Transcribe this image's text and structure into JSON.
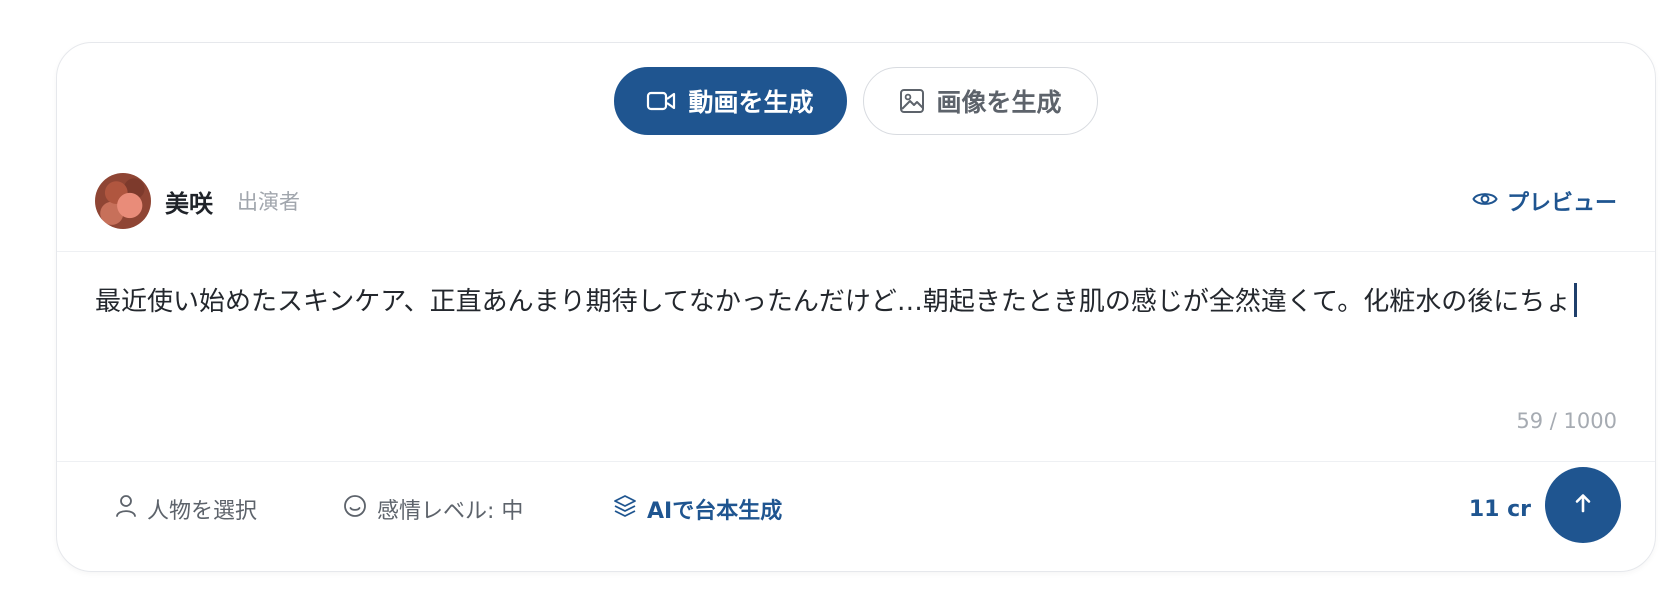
{
  "mode_tabs": {
    "video_label": "動画を生成",
    "image_label": "画像を生成",
    "video_icon": "video-camera-icon",
    "image_icon": "image-icon"
  },
  "performer": {
    "name": "美咲",
    "role": "出演者",
    "preview_label": "プレビュー",
    "preview_icon": "eye-icon"
  },
  "script": {
    "text": "最近使い始めたスキンケア、正直あんまり期待してなかったんだけど…朝起きたとき肌の感じが全然違くて。化粧水の後にちょ",
    "char_count": "59 / 1000"
  },
  "toolbar": {
    "select_person_label": "人物を選択",
    "select_person_icon": "person-icon",
    "emotion_label": "感情レベル: 中",
    "emotion_icon": "smiley-icon",
    "ai_script_label": "AIで台本生成",
    "ai_script_icon": "layers-icon",
    "credits": "11 cr",
    "send_icon": "arrow-up-icon"
  },
  "colors": {
    "accent": "#1f5590",
    "muted_text": "#5d636b",
    "border": "#e6e8ec"
  }
}
